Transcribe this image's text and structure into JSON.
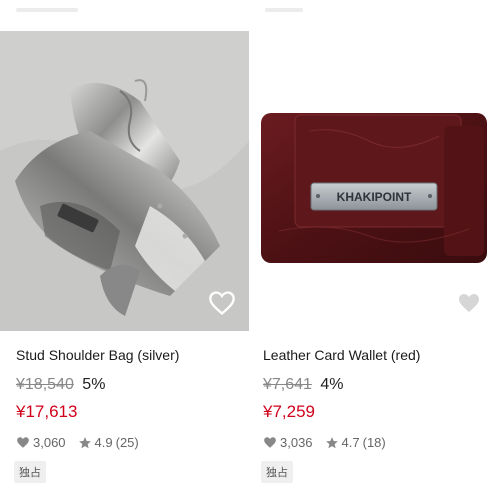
{
  "products": [
    {
      "title": "Stud Shoulder Bag (silver)",
      "original_price": "¥18,540",
      "discount": "5%",
      "sale_price": "¥17,613",
      "likes": "3,060",
      "rating": "4.9",
      "reviews": "(25)",
      "badge": "独占",
      "image_desc": "silver metallic leather shoulder bag with studs and drawstring",
      "favorite_icon": "heart-outline-icon"
    },
    {
      "title": "Leather Card Wallet (red)",
      "original_price": "¥7,641",
      "discount": "4%",
      "sale_price": "¥7,259",
      "likes": "3,036",
      "rating": "4.7",
      "reviews": "(18)",
      "badge": "独占",
      "image_desc": "dark red leather card wallet with metal plate",
      "plate_text": "KHAKIPOINT",
      "favorite_icon": "heart-outline-icon"
    }
  ],
  "colors": {
    "sale": "#d0021b",
    "wallet": "#5c1518",
    "silver": "#b8b8b6"
  }
}
